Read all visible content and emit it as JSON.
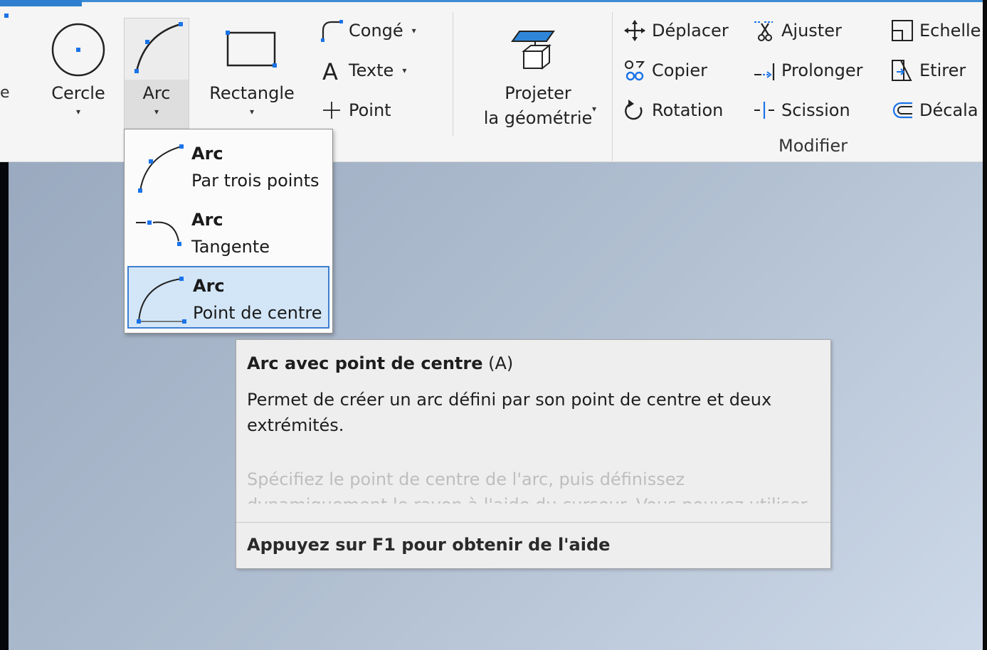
{
  "ribbon": {
    "edge_label": "e",
    "draw": {
      "circle_label": "Cercle",
      "arc_label": "Arc",
      "rectangle_label": "Rectangle",
      "fillet_label": "Congé",
      "text_label": "Texte",
      "point_label": "Point",
      "dropdown_caret": "▾"
    },
    "project": {
      "line1": "Projeter",
      "line2": "la géométrie",
      "caret": "▾"
    },
    "modify": {
      "group_label": "Modifier",
      "move_label": "Déplacer",
      "copy_label": "Copier",
      "rotate_label": "Rotation",
      "trim_label": "Ajuster",
      "extend_label": "Prolonger",
      "split_label": "Scission",
      "scale_label": "Echelle",
      "stretch_label": "Etirer",
      "offset_label": "Décala"
    }
  },
  "arc_menu": {
    "items": [
      {
        "title": "Arc",
        "subtitle": "Par trois points",
        "icon": "arc-three-points-icon"
      },
      {
        "title": "Arc",
        "subtitle": "Tangente",
        "icon": "arc-tangent-icon"
      },
      {
        "title": "Arc",
        "subtitle": "Point de centre",
        "icon": "arc-center-point-icon",
        "selected": true
      }
    ]
  },
  "tooltip": {
    "title_bold": "Arc avec point de centre",
    "shortcut": " (A)",
    "description": "Permet de créer un arc défini par son point de centre et deux extrémités.",
    "more_text": "Spécifiez le point de centre de l'arc, puis définissez dynamiquement le rayon à l'aide du curseur. Vous pouvez utiliser",
    "help_text": "Appuyez sur F1 pour obtenir de l'aide"
  },
  "colors": {
    "accent": "#3c8bd6",
    "ribbon_bg": "#f5f5f5",
    "selection_bg": "#d3e6f8",
    "selection_border": "#3c7fd0",
    "icon_blue": "#1a73e8"
  }
}
